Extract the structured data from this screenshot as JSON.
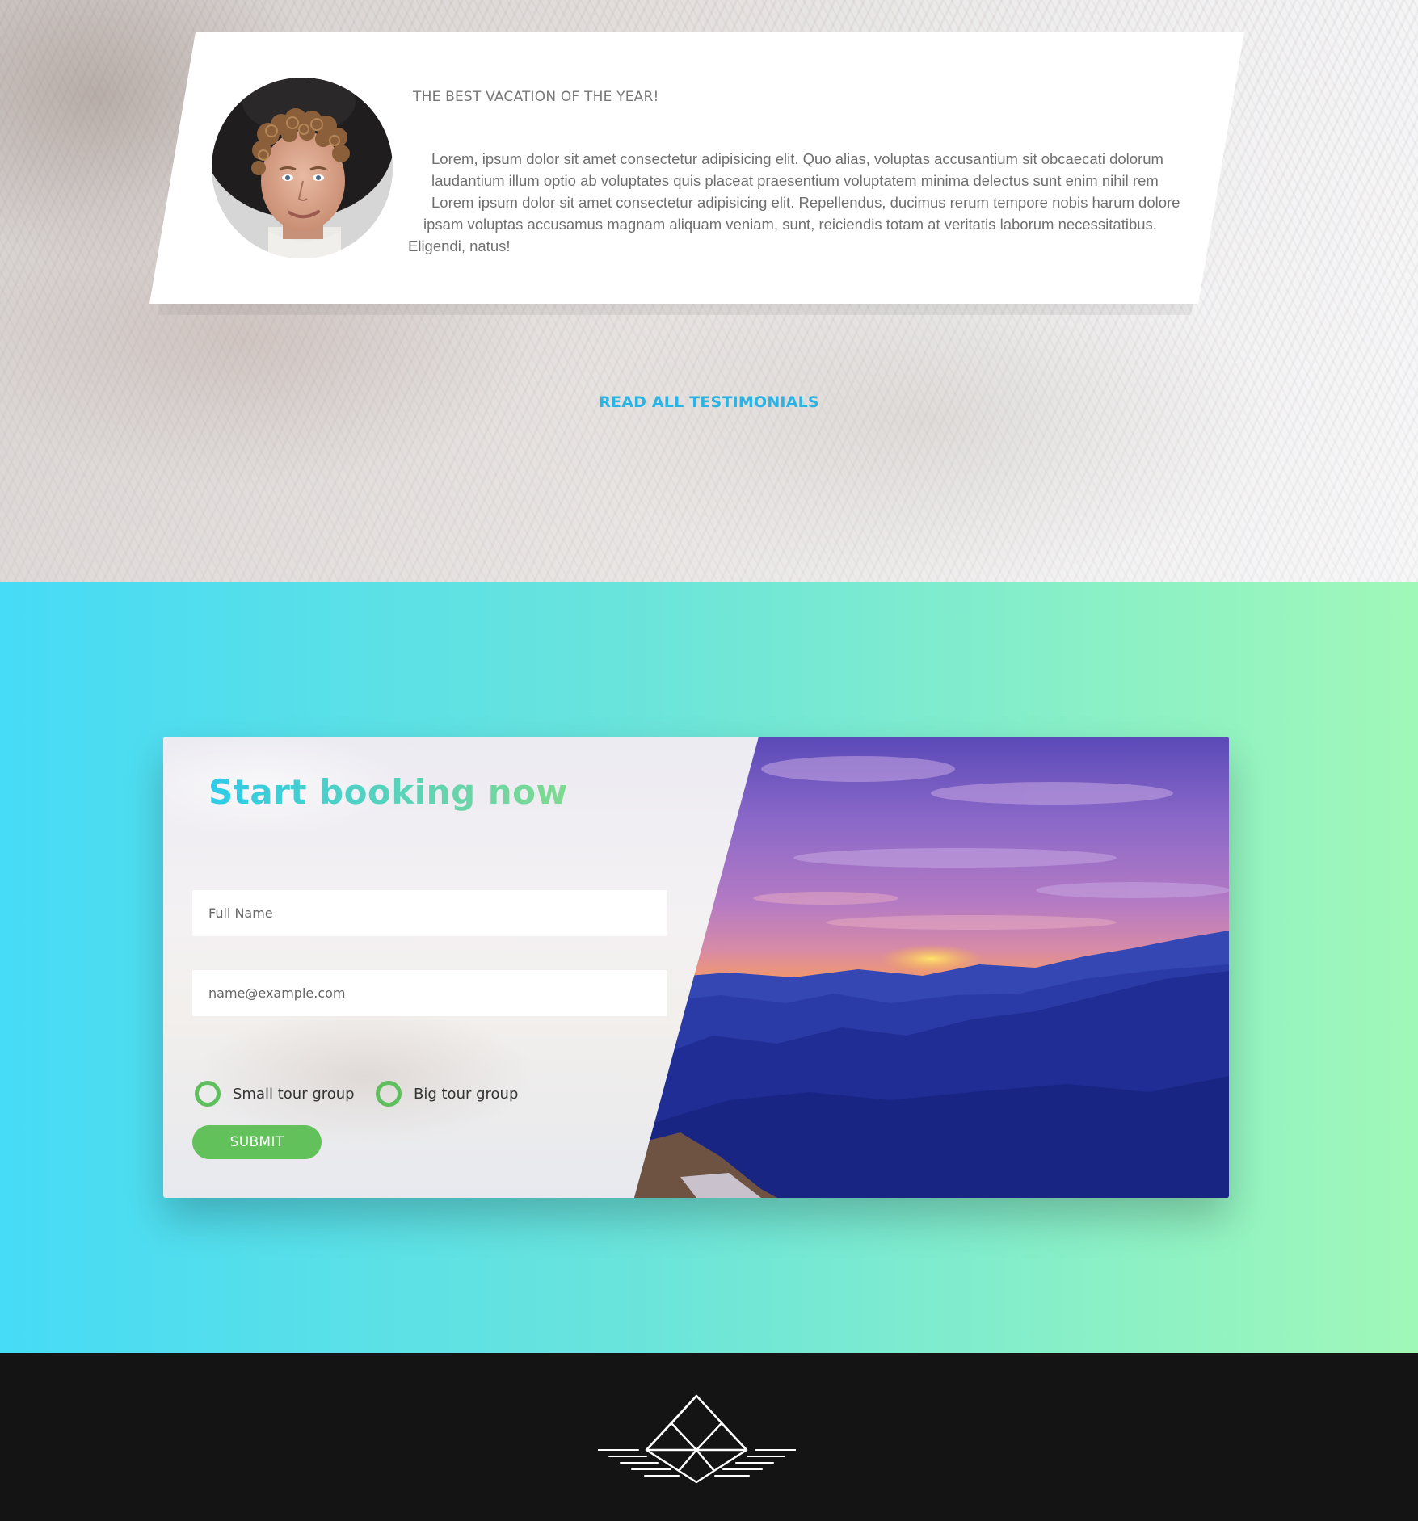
{
  "testimonial": {
    "title": "THE BEST VACATION OF THE YEAR!",
    "text_lines": [
      "Lorem, ipsum dolor sit amet consectetur adipisicing elit. Quo alias, voluptas accusantium sit obcaecati dolorum",
      "laudantium illum optio ab voluptates quis placeat praesentium voluptatem minima delectus sunt enim nihil rem",
      "Lorem ipsum dolor sit amet consectetur adipisicing elit. Repellendus, ducimus rerum tempore nobis harum dolore",
      "ipsam voluptas accusamus magnam aliquam veniam, sunt, reiciendis totam at veritatis laborum necessitatibus.",
      "Eligendi, natus!"
    ],
    "read_all_label": "READ ALL TESTIMONIALS"
  },
  "booking": {
    "heading": "Start booking now",
    "name_placeholder": "Full Name",
    "email_placeholder": "name@example.com",
    "options": [
      "Small tour group",
      "Big tour group"
    ],
    "submit_label": "SUBMIT"
  },
  "colors": {
    "accent_blue": "#28b4e6",
    "radio_green": "#5fbf5f",
    "submit_green": "#62c15a",
    "footer_bg": "#141414"
  },
  "icons": {
    "footer_logo": "mountain-logo-icon"
  }
}
